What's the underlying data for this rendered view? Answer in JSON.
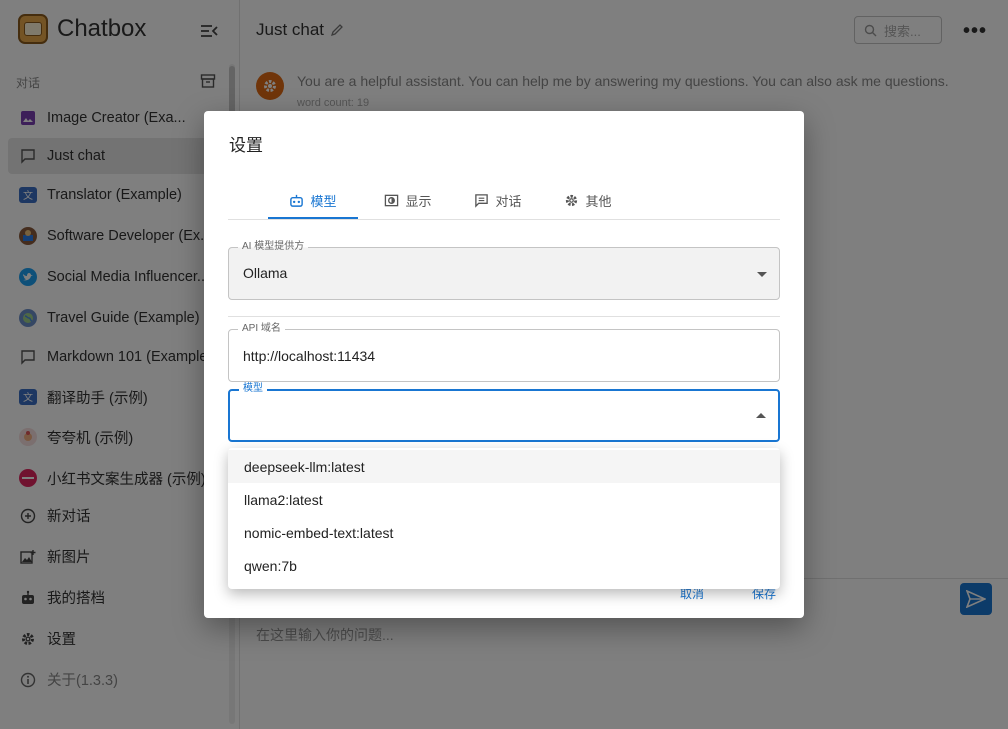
{
  "app": {
    "name": "Chatbox",
    "section_label": "对话"
  },
  "sessions": [
    {
      "label": "Image Creator (Exa...",
      "icon": "image-icon",
      "color": "#7b3fb2"
    },
    {
      "label": "Just chat",
      "icon": "chat-bubble-icon",
      "color": "#555555"
    },
    {
      "label": "Translator (Example)",
      "icon": "translator-avatar-icon",
      "color": "#3b6fc4"
    },
    {
      "label": "Software Developer (Ex...",
      "icon": "developer-avatar-icon",
      "color": "#d9534f"
    },
    {
      "label": "Social Media Influencer...",
      "icon": "twitter-avatar-icon",
      "color": "#1da1f2"
    },
    {
      "label": "Travel Guide (Example)",
      "icon": "globe-avatar-icon",
      "color": "#6b8fc9"
    },
    {
      "label": "Markdown 101 (Example)",
      "icon": "chat-bubble-icon",
      "color": "#555555"
    },
    {
      "label": "翻译助手 (示例)",
      "icon": "translator-avatar-icon",
      "color": "#3b6fc4"
    },
    {
      "label": "夸夸机 (示例)",
      "icon": "cheer-avatar-icon",
      "color": "#e8a1a1"
    },
    {
      "label": "小红书文案生成器 (示例)",
      "icon": "xiaohongshu-avatar-icon",
      "color": "#e0245e"
    }
  ],
  "bottom_nav": {
    "new_chat": "新对话",
    "new_image": "新图片",
    "copilots": "我的搭档",
    "settings": "设置",
    "about": "关于(1.3.3)"
  },
  "main": {
    "chat_title": "Just chat",
    "search_placeholder": "搜索...",
    "system_message": "You are a helpful assistant. You can help me by answering my questions. You can also ask me questions.",
    "word_count": "word count: 19",
    "input_placeholder": "在这里输入你的问题..."
  },
  "dialog": {
    "title": "设置",
    "tabs": [
      {
        "label": "模型",
        "icon": "robot-icon",
        "active": true
      },
      {
        "label": "显示",
        "icon": "display-icon",
        "active": false
      },
      {
        "label": "对话",
        "icon": "chat-icon",
        "active": false
      },
      {
        "label": "其他",
        "icon": "gear-icon",
        "active": false
      }
    ],
    "provider": {
      "label": "AI 模型提供方",
      "value": "Ollama"
    },
    "api_host": {
      "label": "API 域名",
      "value": "http://localhost:11434"
    },
    "model": {
      "label": "模型",
      "value": ""
    },
    "cancel_label": "取消",
    "save_label": "保存"
  },
  "model_options": [
    "deepseek-llm:latest",
    "llama2:latest",
    "nomic-embed-text:latest",
    "qwen:7b"
  ],
  "colors": {
    "accent": "#1976d2",
    "system_avatar": "#e06b14",
    "backdrop": "rgba(0,0,0,0.5)"
  }
}
